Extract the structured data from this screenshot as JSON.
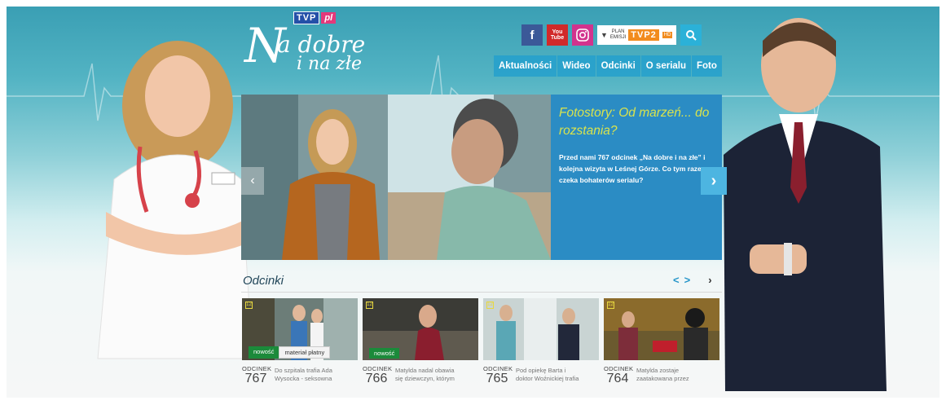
{
  "brand": {
    "tvp_logo": "TVP",
    "tvp_suffix": "pl",
    "show_logo_big": "N",
    "show_logo_line1": "a dobre",
    "show_logo_line2": "i na złe"
  },
  "social": {
    "facebook": "f",
    "youtube_line1": "You",
    "youtube_line2": "Tube",
    "schedule_text_1": "PLAN",
    "schedule_text_2": "EMISJI",
    "channel": "TVP2",
    "hd": "HD"
  },
  "nav": {
    "items": [
      "Aktualności",
      "Wideo",
      "Odcinki",
      "O serialu",
      "Foto"
    ]
  },
  "hero": {
    "title": "Fotostory: Od marzeń... do rozstania?",
    "description": "Przed nami 767 odcinek „Na dobre i na złe” i kolejna wizyta w Leśnej Górze. Co tym razem czeka bohaterów serialu?",
    "prev_arrow": "‹",
    "next_arrow": "›"
  },
  "episodes": {
    "heading": "Odcinki",
    "prev": "<",
    "next": ">",
    "more": "›",
    "items": [
      {
        "rating": "12",
        "label": "ODCINEK",
        "number": "767",
        "desc1": "Do szpitala trafia Ada",
        "desc2": "Wysocka - seksowna",
        "badge_new": "nowość",
        "badge_paid": "materiał płatny"
      },
      {
        "rating": "12",
        "label": "ODCINEK",
        "number": "766",
        "desc1": "Matylda nadal obawia",
        "desc2": "się dziewczyn, którym",
        "badge_new": "nowość",
        "badge_paid": ""
      },
      {
        "rating": "12",
        "label": "ODCINEK",
        "number": "765",
        "desc1": "Pod opiekę Barta i",
        "desc2": "doktor Woźnickiej trafia",
        "badge_new": "",
        "badge_paid": ""
      },
      {
        "rating": "12",
        "label": "ODCINEK",
        "number": "764",
        "desc1": "Matylda zostaje",
        "desc2": "zaatakowana przez",
        "badge_new": "",
        "badge_paid": ""
      }
    ]
  },
  "colors": {
    "accent_blue": "#2b8cc4",
    "hero_title": "#d9e34d",
    "badge_green": "#1b8a3a",
    "channel_orange": "#f28c1e"
  }
}
